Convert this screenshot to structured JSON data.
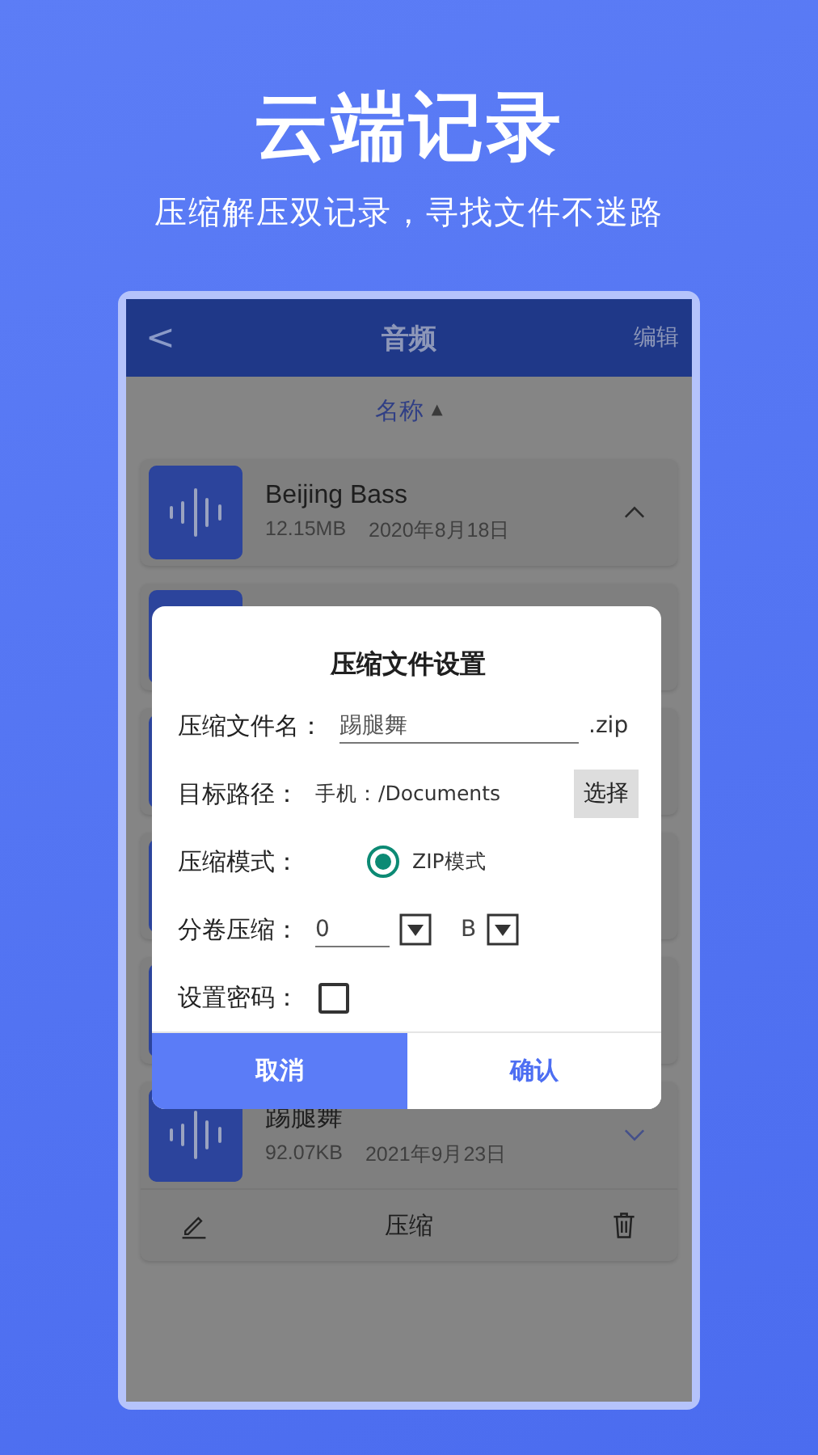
{
  "headline": "云端记录",
  "subheadline": "压缩解压双记录，寻找文件不迷路",
  "app_bar": {
    "back": "<",
    "title": "音频",
    "action": "编辑"
  },
  "sort": {
    "label": "名称",
    "direction": "▲"
  },
  "files": [
    {
      "name": "Beijing Bass",
      "size": "12.15MB",
      "date": "2020年8月18日",
      "expanded": false
    },
    {
      "kind": "hidden"
    },
    {
      "kind": "hidden"
    },
    {
      "kind": "hidden"
    },
    {
      "kind": "hidden"
    },
    {
      "name": "踢腿舞",
      "size": "92.07KB",
      "date": "2021年9月23日",
      "expanded": true,
      "action": "压缩"
    }
  ],
  "dialog": {
    "title": "压缩文件设置",
    "name_label": "压缩文件名：",
    "name_value": "踢腿舞",
    "extension": ".zip",
    "path_label": "目标路径：",
    "path_value": "手机：/Documents",
    "choose_button": "选择",
    "mode_label": "压缩模式：",
    "mode_option": "ZIP模式",
    "mode_selected": true,
    "split_label": "分卷压缩：",
    "split_value": "0",
    "unit": "B",
    "password_label": "设置密码：",
    "password_checked": false,
    "cancel": "取消",
    "confirm": "确认"
  }
}
